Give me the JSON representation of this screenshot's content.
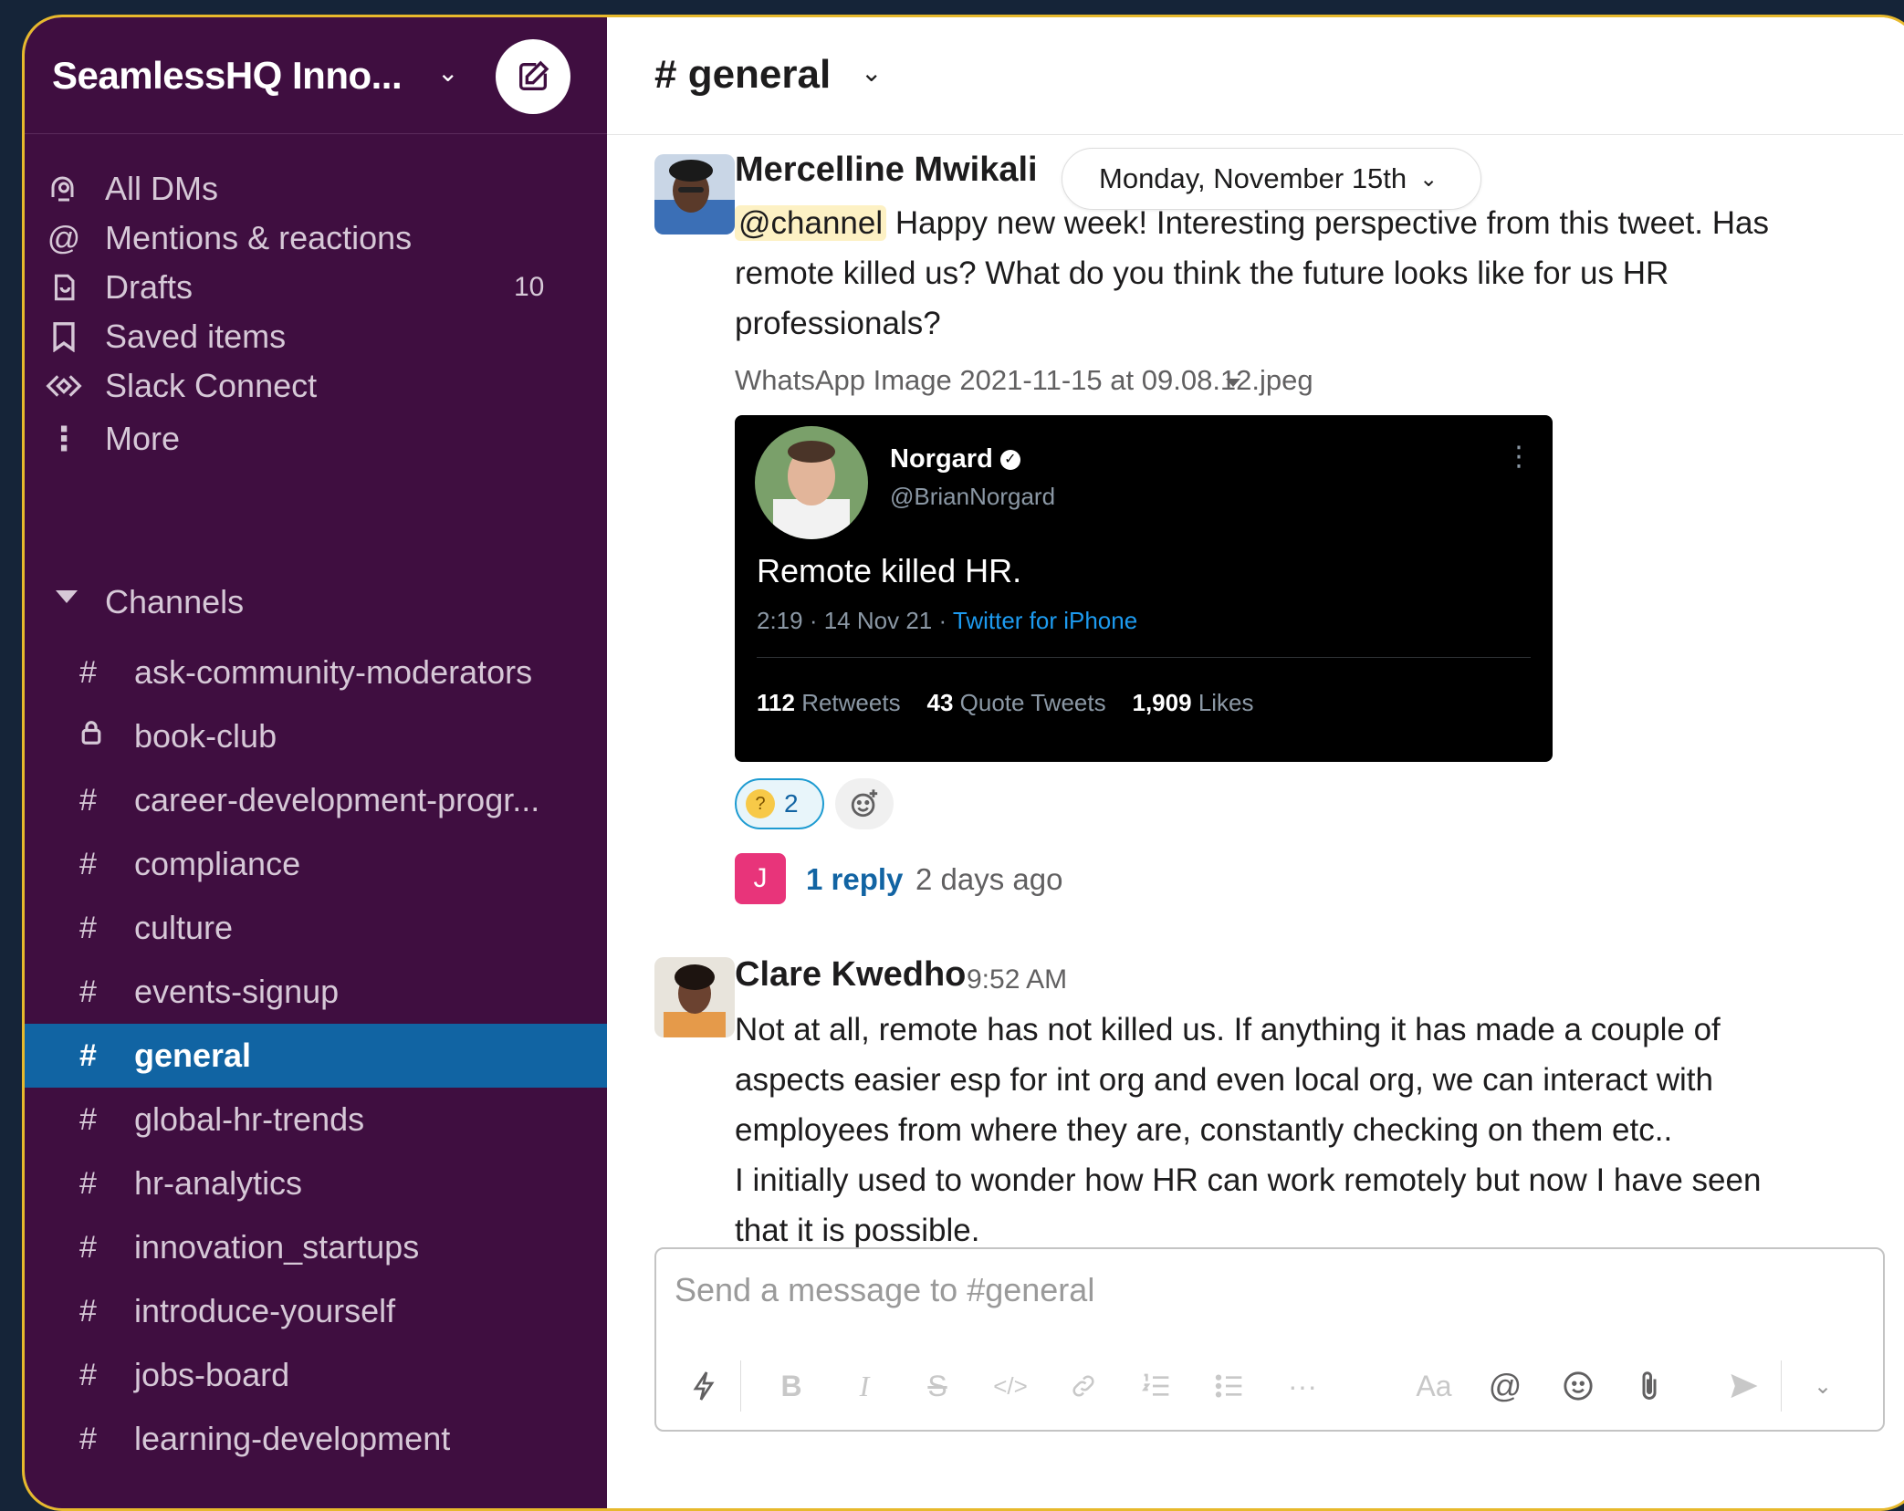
{
  "workspace": {
    "name": "SeamlessHQ Inno..."
  },
  "sidebar": {
    "nav": [
      {
        "label": "All DMs",
        "icon": "dms-icon"
      },
      {
        "label": "Mentions & reactions",
        "icon": "at-icon"
      },
      {
        "label": "Drafts",
        "icon": "drafts-icon",
        "count": "10"
      },
      {
        "label": "Saved items",
        "icon": "bookmark-icon"
      },
      {
        "label": "Slack Connect",
        "icon": "slack-connect-icon"
      },
      {
        "label": "More",
        "icon": "more-vertical-icon"
      }
    ],
    "channels_header": "Channels",
    "channels": [
      {
        "label": "ask-community-moderators",
        "prefix": "#"
      },
      {
        "label": "book-club",
        "prefix": "lock"
      },
      {
        "label": "career-development-progr...",
        "prefix": "#"
      },
      {
        "label": "compliance",
        "prefix": "#"
      },
      {
        "label": "culture",
        "prefix": "#"
      },
      {
        "label": "events-signup",
        "prefix": "#"
      },
      {
        "label": "general",
        "prefix": "#",
        "active": true
      },
      {
        "label": "global-hr-trends",
        "prefix": "#"
      },
      {
        "label": "hr-analytics",
        "prefix": "#"
      },
      {
        "label": "innovation_startups",
        "prefix": "#"
      },
      {
        "label": "introduce-yourself",
        "prefix": "#"
      },
      {
        "label": "jobs-board",
        "prefix": "#"
      },
      {
        "label": "learning-development",
        "prefix": "#"
      }
    ]
  },
  "header": {
    "channel": "# general"
  },
  "date_divider": "Monday, November 15th",
  "messages": [
    {
      "author": "Mercelline Mwikali",
      "mention": "@channel",
      "text_line1": " Happy new week! Interesting perspective from this tweet. Has",
      "text_line2": "remote killed us? What do you think the future looks like for us HR",
      "text_line3": "professionals?",
      "file_name": "WhatsApp Image 2021-11-15 at 09.08.12.jpeg",
      "tweet": {
        "name": "Norgard",
        "handle": "@BrianNorgard",
        "body": "Remote killed HR.",
        "meta": "2:19 · 14 Nov 21 · ",
        "source": "Twitter for iPhone",
        "retweets": "112",
        "retweets_label": "Retweets",
        "quotes": "43",
        "quotes_label": "Quote Tweets",
        "likes": "1,909",
        "likes_label": "Likes"
      },
      "reaction_count": "2",
      "reply_avatar": "J",
      "reply_count": "1 reply",
      "reply_time": "2 days ago"
    },
    {
      "author": "Clare Kwedho",
      "time": "9:52 AM",
      "lines": [
        "Not at all, remote has not killed us.  If anything it has made a couple of",
        "aspects easier esp for int org and even local org, we can interact with",
        "employees from where they are, constantly checking on them etc..",
        "I initially used to wonder how HR can work remotely but now I have seen",
        "that it is possible."
      ]
    }
  ],
  "composer": {
    "placeholder": "Send a message to #general",
    "aa_label": "Aa"
  },
  "colors": {
    "sidebar_bg": "#3f0e40",
    "active_channel": "#1164a3",
    "frame_border": "#e7b92c",
    "link": "#1264a3"
  }
}
